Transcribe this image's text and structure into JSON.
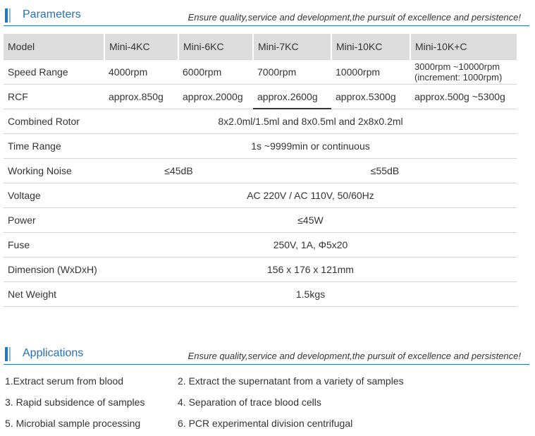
{
  "parameters": {
    "title": "Parameters",
    "slogan": "Ensure quality,service and development,the pursuit of excellence and persistence!",
    "header": [
      "Model",
      "Mini-4KC",
      "Mini-6KC",
      "Mini-7KC",
      "Mini-10KC",
      "Mini-10K+C"
    ],
    "speed": {
      "label": "Speed Range",
      "values": [
        "4000rpm",
        "6000rpm",
        "7000rpm",
        "10000rpm"
      ],
      "last_line1": "3000rpm ~10000rpm",
      "last_line2": "(increment: 1000rpm)"
    },
    "rcf": {
      "label": "RCF",
      "values": [
        "approx.850g",
        "approx.2000g",
        "approx.2600g",
        "approx.5300g",
        "approx.500g ~5300g"
      ]
    },
    "rotor": {
      "label": "Combined Rotor",
      "value": "8x2.0ml/1.5ml and 8x0.5ml and 2x8x0.2ml"
    },
    "time": {
      "label": "Time Range",
      "value": "1s ~9999min or continuous"
    },
    "noise": {
      "label": "Working Noise",
      "value_a": "≤45dB",
      "value_b": "≤55dB"
    },
    "voltage": {
      "label": "Voltage",
      "value": "AC 220V / AC 110V, 50/60Hz"
    },
    "power": {
      "label": "Power",
      "value": "≤45W"
    },
    "fuse": {
      "label": "Fuse",
      "value": "250V, 1A, Φ5x20"
    },
    "dimension": {
      "label": "Dimension (WxDxH)",
      "value": "156 x 176 x 121mm"
    },
    "weight": {
      "label": "Net Weight",
      "value": "1.5kgs"
    }
  },
  "applications": {
    "title": "Applications",
    "slogan": "Ensure quality,service and development,the pursuit of excellence and persistence!",
    "items": [
      "1.Extract serum from blood",
      "2. Extract the supernatant from a variety of samples",
      "3. Rapid subsidence of samples",
      "4. Separation of trace blood cells",
      "5. Microbial sample processing",
      "6. PCR experimental division centrifugal"
    ]
  }
}
